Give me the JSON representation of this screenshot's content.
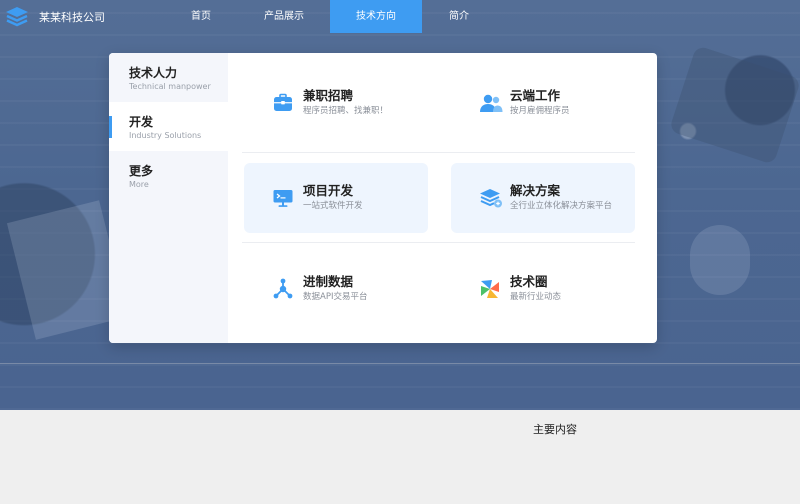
{
  "brand": {
    "name": "某某科技公司"
  },
  "nav": {
    "items": [
      {
        "label": "首页"
      },
      {
        "label": "产品展示"
      },
      {
        "label": "技术方向",
        "active": true
      },
      {
        "label": "简介"
      }
    ]
  },
  "dropdown": {
    "categories": [
      {
        "title": "技术人力",
        "subtitle": "Technical manpower"
      },
      {
        "title": "开发",
        "subtitle": "Industry Solutions",
        "active": true
      },
      {
        "title": "更多",
        "subtitle": "More"
      }
    ],
    "cards": [
      {
        "title": "兼职招聘",
        "subtitle": "程序员招聘、找兼职！",
        "icon": "briefcase-icon"
      },
      {
        "title": "云端工作",
        "subtitle": "按月雇佣程序员",
        "icon": "users-icon"
      },
      {
        "title": "项目开发",
        "subtitle": "一站式软件开发",
        "icon": "monitor-code-icon",
        "highlighted": true
      },
      {
        "title": "解决方案",
        "subtitle": "全行业立体化解决方案平台",
        "icon": "layers-icon",
        "highlighted": true
      },
      {
        "title": "进制数据",
        "subtitle": "数据API交易平台",
        "icon": "network-nodes-icon"
      },
      {
        "title": "技术圈",
        "subtitle": "最新行业动态",
        "icon": "colorful-pinwheel-icon"
      }
    ]
  },
  "main": {
    "label": "主要内容"
  },
  "colors": {
    "accent": "#3e9cf2",
    "hero": "#4c6791",
    "panel_side": "#f4f6fb",
    "card_highlight": "#eef5fe"
  }
}
